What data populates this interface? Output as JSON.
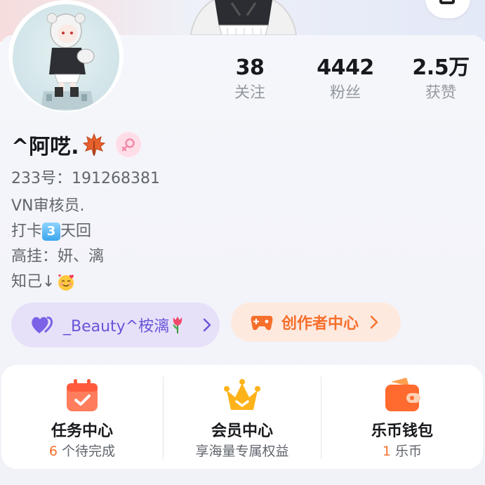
{
  "stats": [
    {
      "value": "38",
      "label": "关注"
    },
    {
      "value": "4442",
      "label": "粉丝"
    },
    {
      "value": "2.5万",
      "label": "获赞"
    }
  ],
  "profile": {
    "name": "^阿呓.",
    "uid": "233号：191268381",
    "bio_lines": [
      "VN审核员.",
      "打卡",
      "天回",
      "高挂：妍、漓",
      "知己↓"
    ],
    "checkin_badge": "3"
  },
  "pills": {
    "fan": "_Beauty^桉漓",
    "creator": "创作者中心"
  },
  "services": [
    {
      "title": "任务中心",
      "sub_highlight": "6",
      "sub": " 个待完成"
    },
    {
      "title": "会员中心",
      "sub_highlight": "",
      "sub": "享海量专属权益"
    },
    {
      "title": "乐币钱包",
      "sub_highlight": "1",
      "sub": " 乐币"
    }
  ],
  "colors": {
    "accent_orange": "#f66f2c",
    "accent_purple": "#6a54d8",
    "gender_pink": "#f08aa8"
  }
}
